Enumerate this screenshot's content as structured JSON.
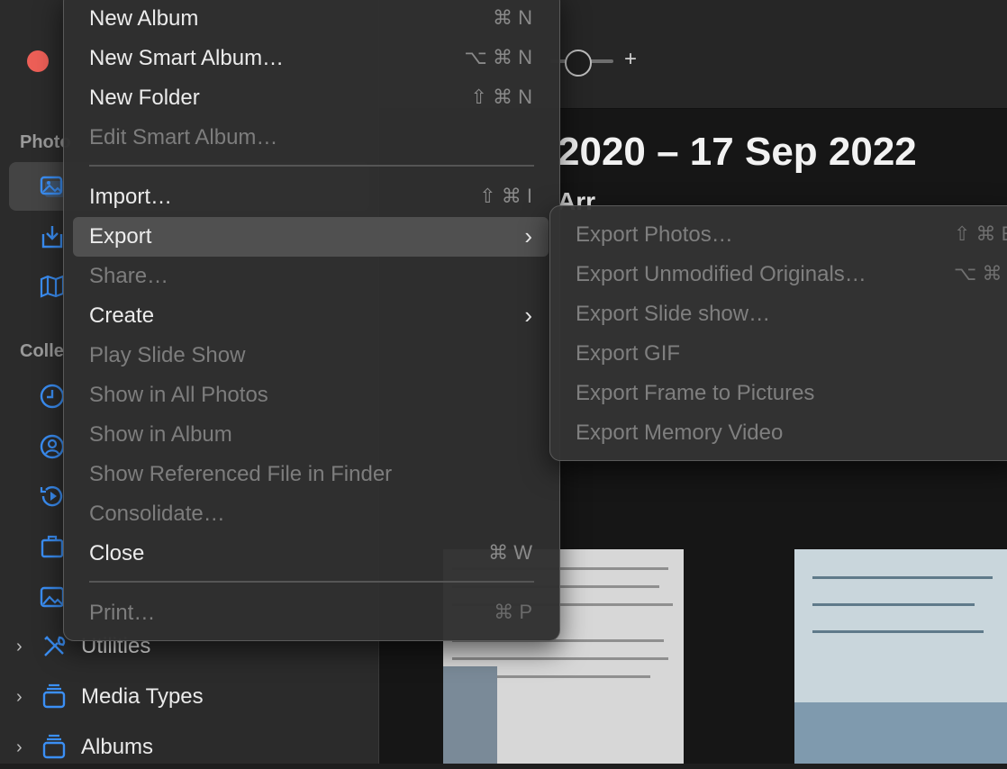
{
  "sidebar": {
    "headers": [
      "Photo",
      "Colle"
    ],
    "groups": [
      {
        "label": "Utilities",
        "icon": "tools-icon"
      },
      {
        "label": "Media Types",
        "icon": "folder-stack-icon"
      },
      {
        "label": "Albums",
        "icon": "folder-stack-icon"
      }
    ]
  },
  "main": {
    "date_range": "2020 – 17 Sep 2022",
    "subtitle": "Arr",
    "zoom_plus": "+"
  },
  "file_menu": {
    "items": [
      {
        "label": "New Album",
        "shortcut": "⌘ N",
        "enabled": true
      },
      {
        "label": "New Smart Album…",
        "shortcut": "⌥ ⌘ N",
        "enabled": true
      },
      {
        "label": "New Folder",
        "shortcut": "⇧ ⌘ N",
        "enabled": true
      },
      {
        "label": "Edit Smart Album…",
        "shortcut": "",
        "enabled": false
      },
      {
        "label": "Import…",
        "shortcut": "⇧ ⌘ I",
        "enabled": true
      },
      {
        "label": "Export",
        "shortcut": "",
        "enabled": true,
        "submenu": true
      },
      {
        "label": "Share…",
        "shortcut": "",
        "enabled": false
      },
      {
        "label": "Create",
        "shortcut": "",
        "enabled": true,
        "submenu": true
      },
      {
        "label": "Play Slide Show",
        "shortcut": "",
        "enabled": false
      },
      {
        "label": "Show in All Photos",
        "shortcut": "",
        "enabled": false
      },
      {
        "label": "Show in Album",
        "shortcut": "",
        "enabled": false
      },
      {
        "label": "Show Referenced File in Finder",
        "shortcut": "",
        "enabled": false
      },
      {
        "label": "Consolidate…",
        "shortcut": "",
        "enabled": false
      },
      {
        "label": "Close",
        "shortcut": "⌘ W",
        "enabled": true
      },
      {
        "label": "Print…",
        "shortcut": "⌘ P",
        "enabled": false
      }
    ]
  },
  "export_submenu": {
    "items": [
      {
        "label": "Export Photos…",
        "shortcut": "⇧ ⌘ E"
      },
      {
        "label": "Export Unmodified Originals…",
        "shortcut": "⌥ ⌘ E"
      },
      {
        "label": "Export Slide show…",
        "shortcut": ""
      },
      {
        "label": "Export GIF",
        "shortcut": ""
      },
      {
        "label": "Export Frame to Pictures",
        "shortcut": ""
      },
      {
        "label": "Export Memory Video",
        "shortcut": ""
      }
    ]
  },
  "colors": {
    "accent": "#3b8ff5",
    "close_button": "#ed5f57",
    "menu_bg": "#303030",
    "highlight": "#505050"
  }
}
